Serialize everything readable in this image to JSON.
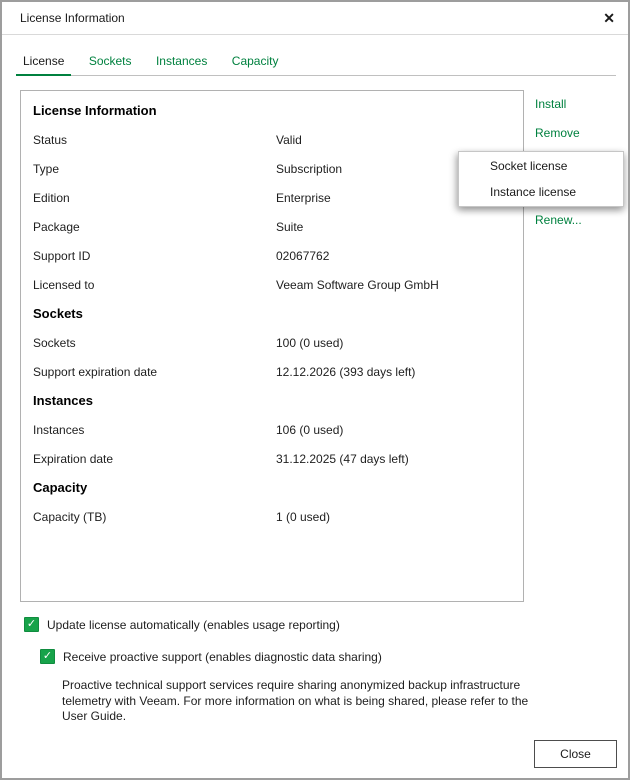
{
  "window": {
    "title": "License Information"
  },
  "icons": {
    "close": "✕",
    "check": "✓"
  },
  "tabs": [
    {
      "label": "License",
      "active": true
    },
    {
      "label": "Sockets",
      "active": false
    },
    {
      "label": "Instances",
      "active": false
    },
    {
      "label": "Capacity",
      "active": false
    }
  ],
  "panel": {
    "rows": [
      {
        "type": "header",
        "label": "License Information"
      },
      {
        "type": "row",
        "label": "Status",
        "value": "Valid"
      },
      {
        "type": "row",
        "label": "Type",
        "value": "Subscription"
      },
      {
        "type": "row",
        "label": "Edition",
        "value": "Enterprise"
      },
      {
        "type": "row",
        "label": "Package",
        "value": "Suite"
      },
      {
        "type": "row",
        "label": "Support ID",
        "value": "02067762"
      },
      {
        "type": "row",
        "label": "Licensed to",
        "value": "Veeam Software Group GmbH"
      },
      {
        "type": "header",
        "label": "Sockets"
      },
      {
        "type": "row",
        "label": "Sockets",
        "value": "100 (0 used)"
      },
      {
        "type": "row",
        "label": "Support expiration date",
        "value": "12.12.2026 (393 days left)"
      },
      {
        "type": "header",
        "label": "Instances"
      },
      {
        "type": "row",
        "label": "Instances",
        "value": "106 (0 used)"
      },
      {
        "type": "row",
        "label": "Expiration date",
        "value": "31.12.2025 (47 days left)"
      },
      {
        "type": "header",
        "label": "Capacity"
      },
      {
        "type": "row",
        "label": "Capacity (TB)",
        "value": "1 (0 used)"
      }
    ]
  },
  "actions": {
    "install": "Install",
    "remove": "Remove",
    "renew": "Renew..."
  },
  "context_menu": {
    "items": [
      {
        "label": "Socket license"
      },
      {
        "label": "Instance license"
      }
    ]
  },
  "checkboxes": {
    "update_license": {
      "label": "Update license automatically (enables usage reporting)",
      "checked": true
    },
    "proactive_support": {
      "label": "Receive proactive support (enables diagnostic data sharing)",
      "checked": true
    }
  },
  "support_note": "Proactive technical support services require sharing anonymized backup infrastructure telemetry with Veeam. For more information on what is being shared, please refer to the User Guide.",
  "footer": {
    "close_label": "Close"
  },
  "colors": {
    "accent_green": "#00813F",
    "checkbox_green": "#17A34A",
    "border_gray": "#B1B1B1"
  }
}
